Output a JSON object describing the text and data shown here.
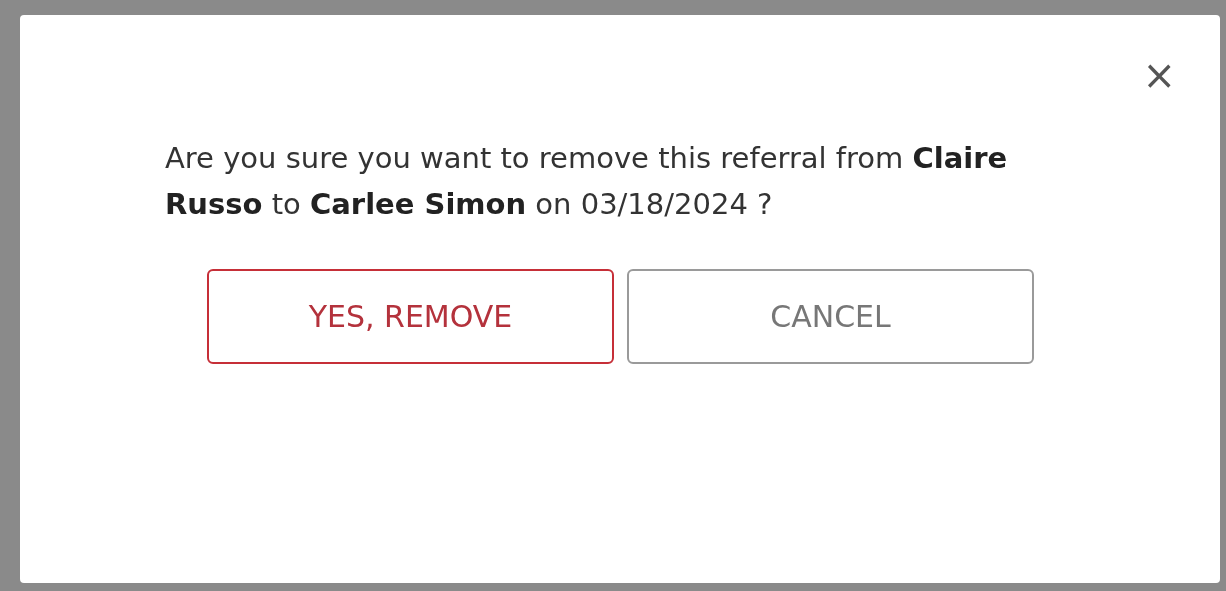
{
  "dialog": {
    "close_label": "×",
    "message": "Are you sure you want to remove this referral from **Claire Russo** to **Carlee Simon** on 03/18/2024 ?",
    "buttons": [
      {
        "label": "YES, REMOVE",
        "kind": "danger"
      },
      {
        "label": "CANCEL",
        "kind": "secondary"
      }
    ]
  }
}
